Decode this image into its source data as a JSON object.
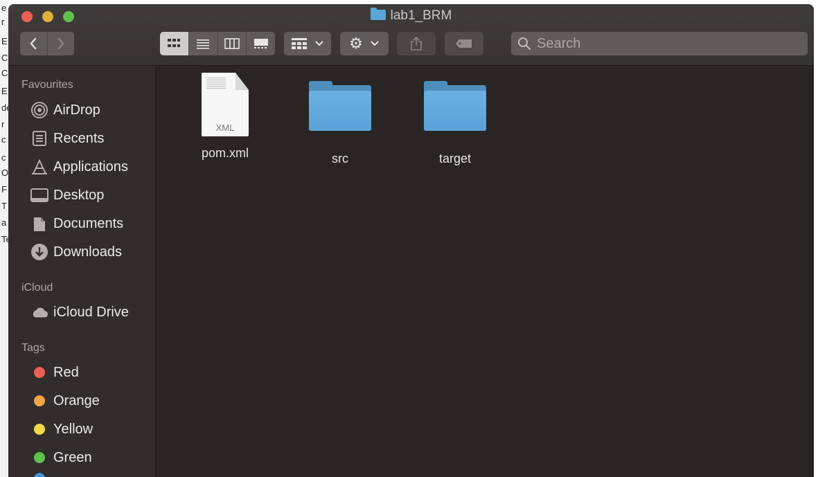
{
  "background_app": {
    "edge_letters": [
      "e",
      "r",
      "E",
      "C",
      "C",
      "E",
      "de",
      "r",
      "c",
      "c",
      "O",
      "F",
      "T",
      "a",
      "Te"
    ]
  },
  "window": {
    "title": "lab1_BRM",
    "title_icon": "folder-icon"
  },
  "toolbar": {
    "back_icon": "chevron-left-icon",
    "forward_icon": "chevron-right-icon",
    "view_modes": [
      "icon-view",
      "list-view",
      "column-view",
      "gallery-view"
    ],
    "group_icon": "group-by-icon",
    "action_icon": "gear-icon",
    "share_icon": "share-icon",
    "tags_icon": "tag-icon",
    "search_placeholder": "Search"
  },
  "sidebar": {
    "favourites_title": "Favourites",
    "favourites": [
      {
        "label": "AirDrop",
        "icon": "airdrop-icon"
      },
      {
        "label": "Recents",
        "icon": "recents-icon"
      },
      {
        "label": "Applications",
        "icon": "applications-icon"
      },
      {
        "label": "Desktop",
        "icon": "desktop-icon"
      },
      {
        "label": "Documents",
        "icon": "documents-icon"
      },
      {
        "label": "Downloads",
        "icon": "downloads-icon"
      }
    ],
    "icloud_title": "iCloud",
    "icloud": [
      {
        "label": "iCloud Drive",
        "icon": "cloud-icon"
      }
    ],
    "tags_title": "Tags",
    "tags": [
      {
        "label": "Red",
        "color": "#ec5f57"
      },
      {
        "label": "Orange",
        "color": "#f1a545"
      },
      {
        "label": "Yellow",
        "color": "#f4d84a"
      },
      {
        "label": "Green",
        "color": "#5fc24d"
      }
    ]
  },
  "files": [
    {
      "name": "pom.xml",
      "kind": "document",
      "ext_label": "XML"
    },
    {
      "name": "src",
      "kind": "folder"
    },
    {
      "name": "target",
      "kind": "folder"
    }
  ]
}
